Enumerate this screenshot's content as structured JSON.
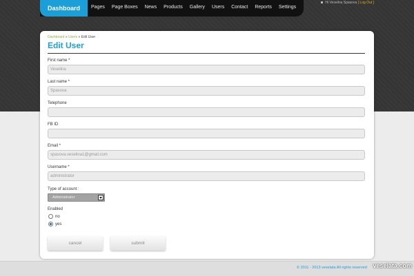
{
  "nav": {
    "dashboard": "Dashboard",
    "items": [
      "Pages",
      "Page Boxes",
      "News",
      "Products",
      "Gallery",
      "Users",
      "Contact",
      "Reports",
      "Settings"
    ]
  },
  "userbar": {
    "prefix": "Hi",
    "user": "Veselina Spasova",
    "logout": "[ Log Out ]"
  },
  "breadcrumb": {
    "home": "Dashboard",
    "sep1": " » ",
    "users": "Users",
    "sep2": " » ",
    "current": "Edit User"
  },
  "page_title": "Edit User",
  "form": {
    "first_name_label": "First name *",
    "first_name_value": "Veselina",
    "last_name_label": "Last name *",
    "last_name_value": "Spasova",
    "telephone_label": "Telephone",
    "telephone_value": "",
    "fb_id_label": "FB ID",
    "fb_id_value": "",
    "email_label": "Email *",
    "email_value": "spasova.veselina1@gmail.com",
    "username_label": "Username *",
    "username_value": "administrator",
    "account_type_label": "Type of account :",
    "account_type_value": "Administrator",
    "enabled_label": "Enabled",
    "enabled_no": "no",
    "enabled_yes": "yes",
    "enabled_selected": "yes",
    "cancel_label": "cancel",
    "submit_label": "submit"
  },
  "footer": {
    "text": "© 2011 - 2013 veselata All rights reserved"
  },
  "watermark": "veselata.com",
  "colors": {
    "accent": "#1a9fd9",
    "breadcrumb_link": "#8ab63b",
    "logout": "#e0b11a",
    "header_bg": "#353535"
  }
}
